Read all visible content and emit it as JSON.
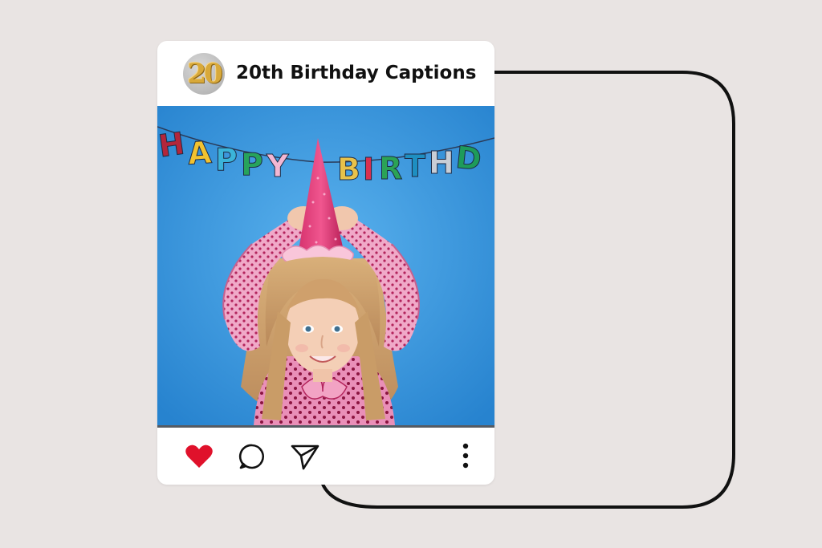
{
  "post": {
    "title": "20th Birthday Captions",
    "avatar_text": "20",
    "photo_alt": "Girl in pink party hat under HAPPY BIRTHDAY banner",
    "banner_letters": [
      "H",
      "A",
      "P",
      "P",
      "Y",
      "B",
      "I",
      "R",
      "T",
      "H",
      "D"
    ]
  },
  "actions": {
    "like_icon": "heart-icon",
    "comment_icon": "comment-icon",
    "share_icon": "paper-plane-icon",
    "more_icon": "vertical-dots-icon",
    "like_color": "#e0112b"
  },
  "colors": {
    "background": "#e9e4e3",
    "card": "#ffffff",
    "photo_background": "#2f92dd",
    "frame_stroke": "#111111"
  }
}
